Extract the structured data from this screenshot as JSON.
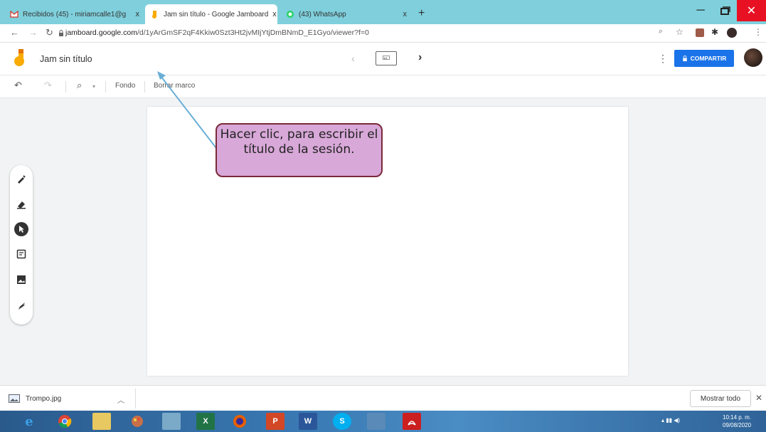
{
  "browser": {
    "tabs": [
      {
        "label": "Recibidos (45) - miriamcalle1@g",
        "icon": "gmail-icon",
        "active": false
      },
      {
        "label": "Jam sin título - Google Jamboard",
        "icon": "jamboard-icon",
        "active": true
      },
      {
        "label": "(43) WhatsApp",
        "icon": "whatsapp-icon",
        "active": false
      }
    ],
    "url_host": "jamboard.google.com",
    "url_path": "/d/1yArGmSF2qF4Kkiw0Szt3Ht2jvMIjYtjDmBNmD_E1Gyo/viewer?f=0",
    "tab_close_glyph": "x",
    "new_tab_glyph": "+"
  },
  "app": {
    "title": "Jam sin título",
    "share_label": "COMPARTIR",
    "prev_glyph": "‹",
    "next_glyph": "›",
    "frame_indicator": "1/1"
  },
  "toolbar": {
    "zoom_glyph": "⌕",
    "fondo_label": "Fondo",
    "borrar_label": "Borrar marco"
  },
  "callout": {
    "text": "Hacer clic, para escribir el título de la sesión."
  },
  "downloads": {
    "file_name": "Trompo.jpg",
    "show_all_label": "Mostrar todo",
    "close_glyph": "✕"
  },
  "taskbar": {
    "excel_label": "X",
    "powerpoint_label": "P",
    "word_label": "W",
    "skype_label": "S",
    "clock_time": "10:14 p. m.",
    "clock_date": "09/08/2020"
  },
  "colors": {
    "tab_strip": "#7fd0dc",
    "share_button": "#1a73e8",
    "callout_fill": "#d8a8d8",
    "callout_border": "#7a2a3a",
    "arrow": "#6aaed6"
  }
}
